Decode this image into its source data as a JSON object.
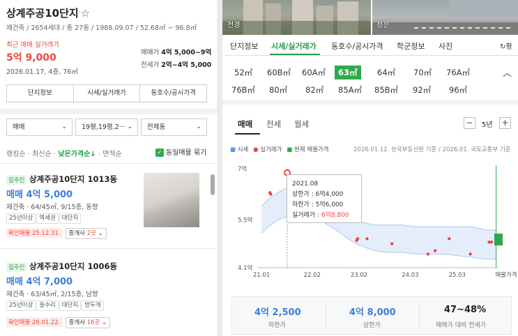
{
  "complex": {
    "title": "상계주공10단지",
    "subtitle": "재건축 / 2654세대 / 총 27동 / 1988.09.07 / 52.68㎡ ~ 96.8㎡",
    "recent_label": "최근 매매 실거래가",
    "recent_price": "5억 9,000",
    "recent_detail": "2026.01.17, 4층, 76㎡",
    "sale_range_label": "매매가",
    "sale_range": "4억 5,000~9억",
    "jeonse_range_label": "전세가",
    "jeonse_range": "2억~4억 5,000",
    "tabs": [
      "단지정보",
      "시세/실거래가",
      "동호수/공시가격"
    ]
  },
  "filters": {
    "trade_type": "매매",
    "area": "19평,19평,2···",
    "dong": "전체동",
    "sort_options": [
      "랭킹순",
      "최신순",
      "낮은가격순↓",
      "면적순"
    ],
    "sort_active": "낮은가격순↓",
    "same_listing_label": "동일매물 묶기"
  },
  "listings": [
    {
      "badge": "집주인",
      "title": "상계주공10단지 1013동",
      "price": "매매 4억 5,000",
      "details": "재건축 · 64/45㎡, 9/15층, 동향",
      "keywords": [
        "25년이상",
        "역세권",
        "대단지"
      ],
      "confirmed": "확인매물 25.12.31.",
      "broker_label": "중개사",
      "broker_count": "2곳"
    },
    {
      "badge": "집주인",
      "title": "상계주공10단지 1006동",
      "price": "매매 4억 7,000",
      "details": "재건축 · 63/45㎡, 2/15층, 남향",
      "keywords": [
        "25년이상",
        "올수리",
        "대단지",
        "방두개"
      ],
      "confirmed": "확인매물 26.01.22.",
      "broker_label": "중개사",
      "broker_count": "16곳"
    }
  ],
  "photos": [
    "전경",
    "정문"
  ],
  "right_tabs": [
    "단지정보",
    "시세/실거래가",
    "동호수/공시가격",
    "학군정보",
    "사진"
  ],
  "right_tab_active": "시세/실거래가",
  "right_tab_extra": "평",
  "area_types": [
    "52㎡",
    "60B㎡",
    "60A㎡",
    "63㎡",
    "64㎡",
    "70㎡",
    "76A㎡",
    "76B㎡",
    "80㎡",
    "82㎡",
    "85A㎡",
    "85B㎡",
    "92㎡",
    "96㎡"
  ],
  "area_active": "63㎡",
  "price_tabs": [
    "매매",
    "전세",
    "월세"
  ],
  "price_tab_active": "매매",
  "period": "5년",
  "legend": {
    "market": "시세",
    "actual": "실거래가",
    "current": "현재 매물가격",
    "source": "2026.01.12. 한국부동산원 기준 / 2026.01. 국토교통부 기준"
  },
  "tooltip": {
    "date": "2021.08",
    "upper_label": "상한가 :",
    "upper": "6억4,000",
    "lower_label": "하한가 :",
    "lower": "5억6,000",
    "actual_label": "실거래가 :",
    "actual": "6억8,800"
  },
  "chart_data": {
    "type": "area",
    "ylabel": "",
    "y_ticks": [
      "7억",
      "5.5억",
      "4.1억"
    ],
    "y_tick_values": [
      7.0,
      5.5,
      4.1
    ],
    "ylim": [
      4.1,
      7.0
    ],
    "x_ticks": [
      "21.01",
      "22.02",
      "23.02",
      "24.03",
      "25.03",
      "매물가격"
    ],
    "x_tick_values": [
      2021.0,
      2022.08,
      2023.08,
      2024.17,
      2025.17
    ],
    "xlim": [
      2021.0,
      2026.05
    ],
    "series": [
      {
        "name": "시세",
        "color": "#a8c8ee",
        "x": [
          2021.0,
          2021.15,
          2021.35,
          2021.55,
          2021.7,
          2021.8,
          2022.0,
          2022.3,
          2022.6,
          2022.9,
          2023.1,
          2023.4,
          2023.7,
          2024.0,
          2024.3,
          2024.6,
          2024.9,
          2025.2,
          2025.5,
          2025.8,
          2026.0
        ],
        "upper": [
          5.9,
          6.1,
          6.3,
          6.45,
          6.55,
          6.5,
          6.45,
          6.3,
          6.05,
          5.65,
          5.45,
          5.35,
          5.35,
          5.35,
          5.3,
          5.3,
          5.3,
          5.3,
          5.3,
          5.2,
          5.2
        ],
        "lower": [
          5.1,
          5.3,
          5.5,
          5.6,
          5.7,
          5.65,
          5.6,
          5.45,
          5.2,
          4.9,
          4.75,
          4.6,
          4.55,
          4.55,
          4.5,
          4.5,
          4.5,
          4.45,
          4.4,
          4.35,
          4.35
        ]
      },
      {
        "name": "실거래가",
        "color": "#f0463c",
        "x": [
          2021.18,
          2021.2,
          2021.55,
          2023.03,
          2023.05,
          2023.25,
          2023.78,
          2024.55,
          2024.7,
          2025.0,
          2025.45,
          2025.85,
          2025.9
        ],
        "y": [
          6.3,
          6.25,
          6.88,
          4.9,
          4.95,
          4.95,
          4.8,
          4.5,
          4.6,
          4.95,
          4.5,
          4.85,
          4.85
        ]
      },
      {
        "name": "현재 매물가격",
        "color": "#2eaa4e",
        "x": [
          2026.05
        ],
        "ymin": [
          4.75
        ],
        "ymax": [
          5.1
        ]
      }
    ],
    "selected_x": 2021.55,
    "grid": false,
    "legend_position": "top-left"
  },
  "stats": [
    {
      "value": "4억 2,500",
      "label": "하한가"
    },
    {
      "value": "4억 8,000",
      "label": "상한가"
    },
    {
      "value": "47~48%",
      "label": "매매가 대비 전세가"
    }
  ]
}
